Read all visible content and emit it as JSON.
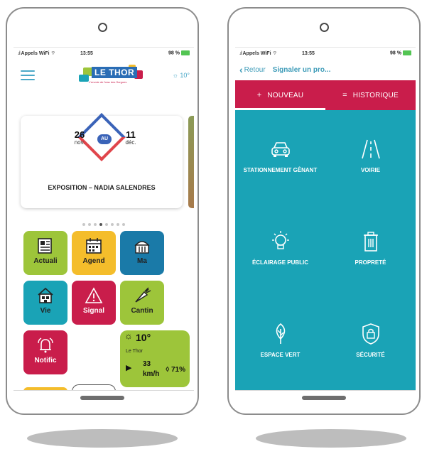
{
  "left_phone": {
    "status": {
      "carrier": "Appels WiFi",
      "time": "13:55",
      "battery": "98 %"
    },
    "header": {
      "logo_text": "LE THOR",
      "logo_tagline": "L'envoie de l'eau des Sorgues",
      "weather_temp": "10°"
    },
    "event": {
      "from_day": "26",
      "from_month": "nov.",
      "connector": "AU",
      "to_day": "11",
      "to_month": "déc.",
      "title": "EXPOSITION – NADIA SALENDRES"
    },
    "tiles": [
      {
        "label": "Actuali",
        "color": "#9dc53a",
        "icon": "newspaper-icon"
      },
      {
        "label": "Agend",
        "color": "#f4bd2b",
        "icon": "calendar-icon"
      },
      {
        "label": "Ma",
        "color": "#1a7aa8",
        "icon": "townhall-icon"
      },
      {
        "label": "Vie",
        "color": "#1aa3b6",
        "icon": "house-icon"
      },
      {
        "label": "Signal",
        "color": "#c91d4b",
        "icon": "warning-icon"
      },
      {
        "label": "Cantin",
        "color": "#9dc53a",
        "icon": "carrot-icon"
      },
      {
        "label": "Notific",
        "color": "#c91d4b",
        "icon": "bell-icon"
      }
    ],
    "weather_tile": {
      "temp": "10°",
      "city": "Le Thor",
      "wind": "33",
      "wind_unit": "km/h",
      "humidity": "71%"
    }
  },
  "right_phone": {
    "status": {
      "carrier": "Appels WiFi",
      "time": "13:55",
      "battery": "98 %"
    },
    "nav": {
      "back": "Retour",
      "title": "Signaler un pro..."
    },
    "tabs": [
      {
        "label": "NOUVEAU"
      },
      {
        "label": "HISTORIQUE"
      }
    ],
    "categories": [
      {
        "label": "STATIONNEMENT GÊNANT",
        "icon": "car-icon"
      },
      {
        "label": "VOIRIE",
        "icon": "road-icon"
      },
      {
        "label": "ÉCLAIRAGE PUBLIC",
        "icon": "lightbulb-icon"
      },
      {
        "label": "PROPRETÉ",
        "icon": "trash-icon"
      },
      {
        "label": "ESPACE VERT",
        "icon": "tree-icon"
      },
      {
        "label": "SÉCURITÉ",
        "icon": "shield-lock-icon"
      }
    ]
  },
  "colors": {
    "teal": "#1aa3b6",
    "crimson": "#c91d4b",
    "green": "#9dc53a",
    "yellow": "#f4bd2b",
    "blue": "#1a7aa8"
  }
}
